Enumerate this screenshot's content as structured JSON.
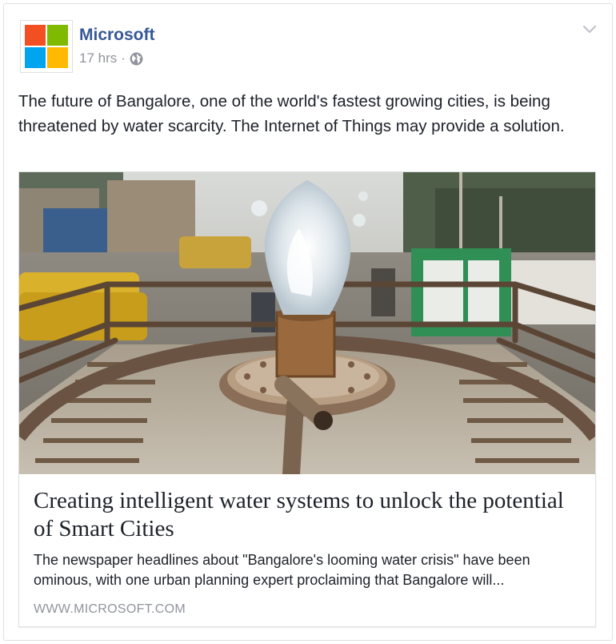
{
  "post": {
    "page_name": "Microsoft",
    "time": "17 hrs",
    "separator": "·",
    "privacy_icon": "globe-icon",
    "menu_icon": "chevron-down-icon",
    "message": "The future of Bangalore, one of the world's fastest growing cities, is being threatened by water scarcity. The Internet of Things may provide a solution."
  },
  "logo": {
    "colors": [
      "#f25022",
      "#7fba00",
      "#00a4ef",
      "#ffb900"
    ]
  },
  "link_card": {
    "image": "photo of water gushing from a pipe on a tanker in a busy street",
    "title": "Creating intelligent water systems to unlock the potential of Smart Cities",
    "description": "The newspaper headlines about \"Bangalore's looming water crisis\" have been ominous, with one urban planning expert proclaiming that Bangalore will...",
    "domain": "WWW.MICROSOFT.COM"
  },
  "colors": {
    "link_blue": "#365899",
    "meta_gray": "#90949c",
    "text": "#1d2129",
    "border": "#dddfe2"
  }
}
